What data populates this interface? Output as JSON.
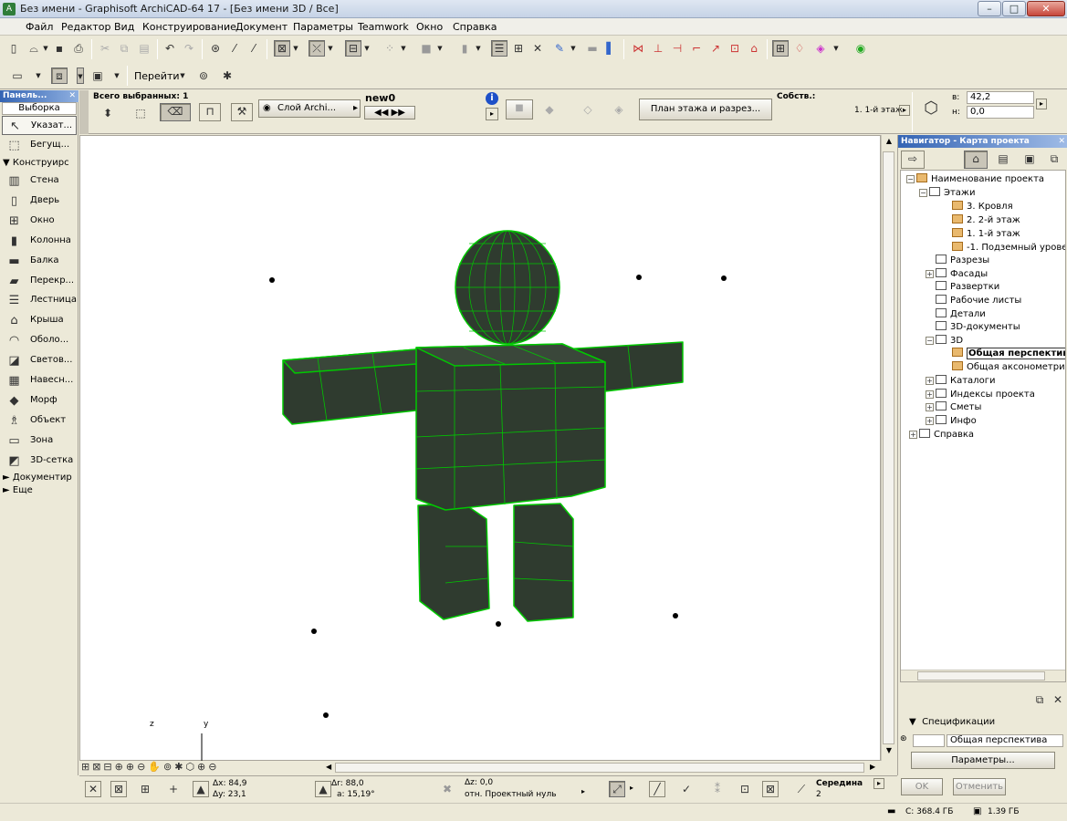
{
  "window": {
    "title": "Без имени - Graphisoft ArchiCAD-64 17 - [Без имени 3D / Все]",
    "minimize": "–",
    "maximize": "□",
    "close": "✕"
  },
  "menu": [
    "Файл",
    "Редактор",
    "Вид",
    "Конструирование",
    "Документ",
    "Параметры",
    "Teamwork",
    "Окно",
    "Справка"
  ],
  "toolbar2": {
    "goto_label": "Перейти"
  },
  "toolbox": {
    "title": "Панель...",
    "selection_label": "Выборка",
    "pointer": "Указат...",
    "marquee": "Бегущ...",
    "design_group": "Конструирс",
    "tools": [
      {
        "label": "Стена",
        "icon": "wall-icon"
      },
      {
        "label": "Дверь",
        "icon": "door-icon"
      },
      {
        "label": "Окно",
        "icon": "window-icon"
      },
      {
        "label": "Колонна",
        "icon": "column-icon"
      },
      {
        "label": "Балка",
        "icon": "beam-icon"
      },
      {
        "label": "Перекр...",
        "icon": "slab-icon"
      },
      {
        "label": "Лестница",
        "icon": "stair-icon"
      },
      {
        "label": "Крыша",
        "icon": "roof-icon"
      },
      {
        "label": "Оболо...",
        "icon": "shell-icon"
      },
      {
        "label": "Светов...",
        "icon": "skylight-icon"
      },
      {
        "label": "Навесн...",
        "icon": "curtain-wall-icon"
      },
      {
        "label": "Морф",
        "icon": "morph-icon"
      },
      {
        "label": "Объект",
        "icon": "object-icon"
      },
      {
        "label": "Зона",
        "icon": "zone-icon"
      },
      {
        "label": "3D-сетка",
        "icon": "mesh-icon"
      }
    ],
    "documents_group": "Документир",
    "more_group": "Еще"
  },
  "infobox": {
    "selected": "Всего выбранных: 1",
    "layer": "Слой Archi...",
    "layer_name": "new0",
    "view_button": "План этажа и разрез...",
    "props_label": "Собств.:",
    "floor": "1. 1-й этаж",
    "height_label": "в:",
    "height_value": "42,2",
    "offset_label": "н:",
    "offset_value": "0,0"
  },
  "viewport": {
    "axis_z": "z",
    "axis_y": "y"
  },
  "navigator": {
    "title": "Навигатор - Карта проекта",
    "tree": {
      "project": "Наименование проекта",
      "stories": "Этажи",
      "story_list": [
        "3. Кровля",
        "2. 2-й этаж",
        "1. 1-й этаж",
        "-1. Подземный уровень"
      ],
      "sections": "Разрезы",
      "elevations": "Фасады",
      "int_elevations": "Развертки",
      "worksheets": "Рабочие листы",
      "details": "Детали",
      "docs3d": "3D-документы",
      "threeD": "3D",
      "persp": "Общая перспектива",
      "axono": "Общая аксонометрия",
      "schedules": "Каталоги",
      "indexes": "Индексы проекта",
      "estimates": "Сметы",
      "info": "Инфо",
      "help": "Справка"
    },
    "specs_label": "Спецификации",
    "specs_value": "Общая перспектива",
    "params_button": "Параметры..."
  },
  "status": {
    "dx": "Δx: 84,9",
    "dy": "Δy: 23,1",
    "dr": "Δr: 88,0",
    "angle": "a: 15,19°",
    "dz": "Δz: 0,0",
    "ref": "отн. Проектный нуль",
    "snap": "Середина",
    "snap_n": "2",
    "ok": "OK",
    "cancel": "Отменить",
    "disk": "C: 368.4 ГБ",
    "ram": "1.39 ГБ"
  },
  "colors": {
    "model_fill": "#2f3b2f",
    "model_edge": "#00c800"
  }
}
